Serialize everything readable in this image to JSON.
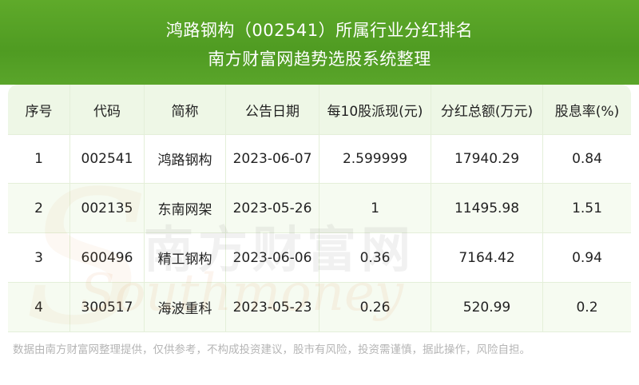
{
  "header": {
    "title_line1": "鸿路钢构（002541）所属行业分红排名",
    "title_line2": "南方财富网趋势选股系统整理"
  },
  "table": {
    "columns": [
      "序号",
      "代码",
      "简称",
      "公告日期",
      "每10股派现(元)",
      "分红总额(万元)",
      "股息率(%)"
    ],
    "rows": [
      [
        "1",
        "002541",
        "鸿路钢构",
        "2023-06-07",
        "2.599999",
        "17940.29",
        "0.84"
      ],
      [
        "2",
        "002135",
        "东南网架",
        "2023-05-26",
        "1",
        "11495.98",
        "1.51"
      ],
      [
        "3",
        "600496",
        "精工钢构",
        "2023-06-06",
        "0.36",
        "7164.42",
        "0.94"
      ],
      [
        "4",
        "300517",
        "海波重科",
        "2023-05-23",
        "0.26",
        "520.99",
        "0.2"
      ]
    ]
  },
  "watermark": {
    "brand_cn": "南方财富网",
    "brand_en": "Southmoney"
  },
  "footer": {
    "disclaimer": "数据由南方财富网整理提供，仅供参考，不构成投资建议，股市有风险，投资需谨慎，据此操作，风险自担。"
  },
  "colors": {
    "header_green": "#4f9b22",
    "table_head_bg": "#eef7e6",
    "row_alt_bg": "#f6fbf1"
  }
}
